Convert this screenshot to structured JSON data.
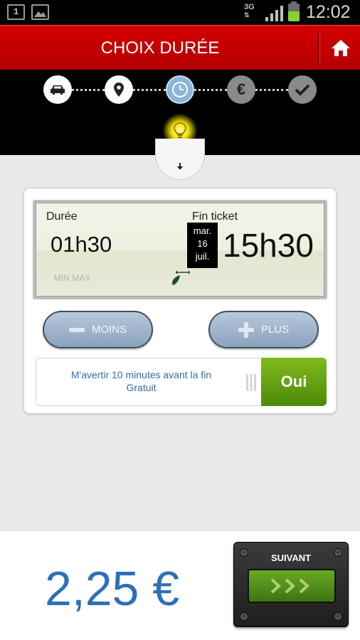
{
  "status_bar": {
    "notification_count": "1",
    "network": "3G",
    "battery_level": 0.55,
    "time": "12:02"
  },
  "header": {
    "title": "CHOIX DURÉE",
    "home_icon": "home-icon",
    "color": "#c80000"
  },
  "steps": [
    {
      "icon": "car-icon",
      "state": "done"
    },
    {
      "icon": "location-pin-icon",
      "state": "done"
    },
    {
      "icon": "clock-icon",
      "state": "current"
    },
    {
      "icon": "euro-icon",
      "state": "todo"
    },
    {
      "icon": "check-icon",
      "state": "todo"
    }
  ],
  "hint_icon": "lightbulb-icon",
  "ticket": {
    "duration_label": "Durée",
    "duration_value": "01h30",
    "end_label": "Fin ticket",
    "date_day": "mar.",
    "date_num": "16",
    "date_month": "juil.",
    "end_value": "15h30",
    "min_max": "MIN MAX"
  },
  "controls": {
    "minus_label": "MOINS",
    "plus_label": "PLUS"
  },
  "alert": {
    "line1": "M'avertir 10 minutes avant la fin",
    "line2": "Gratuit",
    "toggle_label": "Oui"
  },
  "footer": {
    "price": "2,25 €",
    "next_label": "SUIVANT",
    "accent": "#2c71b8"
  }
}
